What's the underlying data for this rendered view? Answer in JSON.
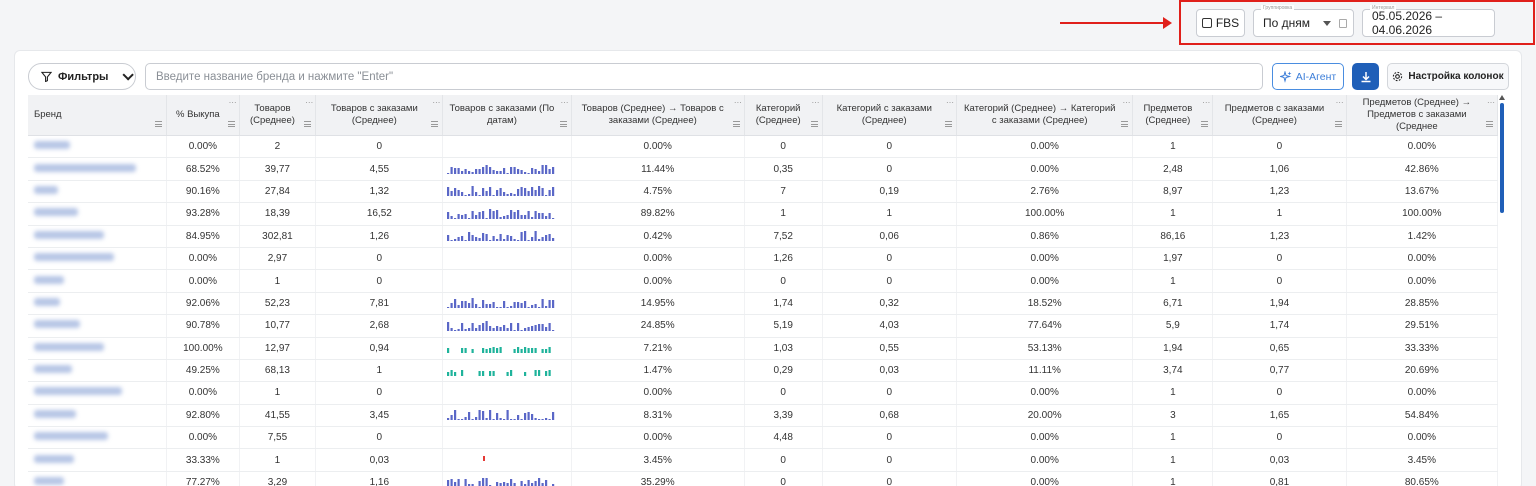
{
  "toolbar": {
    "fbs_label": "FBS",
    "grouping": {
      "label": "Группировка",
      "value": "По дням"
    },
    "interval": {
      "label": "Интервал",
      "value": "05.05.2026 – 04.06.2026"
    }
  },
  "filters": {
    "button_label": "Фильтры",
    "search_placeholder": "Введите название бренда и нажмите \"Enter\"",
    "ai_label": "AI-Агент",
    "columns_label": "Настройка колонок"
  },
  "colors": {
    "accent": "#1f5fb8",
    "highlight": "#e0201b",
    "spark_blue": "#5a67c7",
    "spark_teal": "#1fb39b",
    "spark_red": "#e53935"
  },
  "table": {
    "headers": [
      "Бренд",
      "% Выкупа",
      "Товаров (Среднее)",
      "Товаров с заказами (Среднее)",
      "Товаров с заказами (По датам)",
      "Товаров (Среднее) → Товаров с заказами (Среднее)",
      "Категорий (Среднее)",
      "Категорий с заказами (Среднее)",
      "Категорий (Среднее) → Категорий с заказами (Среднее)",
      "Предметов (Среднее)",
      "Предметов с заказами (Среднее)",
      "Предметов (Среднее) → Предметов с заказами (Среднее"
    ],
    "rows": [
      {
        "c": [
          "0.00%",
          "2",
          "0",
          "0.00%",
          "0",
          "0",
          "0.00%",
          "1",
          "0",
          "0.00%"
        ],
        "spark": "none"
      },
      {
        "c": [
          "68.52%",
          "39,77",
          "4,55",
          "11.44%",
          "0,35",
          "0",
          "0.00%",
          "2,48",
          "1,06",
          "42.86%"
        ],
        "spark": "blue"
      },
      {
        "c": [
          "90.16%",
          "27,84",
          "1,32",
          "4.75%",
          "7",
          "0,19",
          "2.76%",
          "8,97",
          "1,23",
          "13.67%"
        ],
        "spark": "blue"
      },
      {
        "c": [
          "93.28%",
          "18,39",
          "16,52",
          "89.82%",
          "1",
          "1",
          "100.00%",
          "1",
          "1",
          "100.00%"
        ],
        "spark": "blue"
      },
      {
        "c": [
          "84.95%",
          "302,81",
          "1,26",
          "0.42%",
          "7,52",
          "0,06",
          "0.86%",
          "86,16",
          "1,23",
          "1.42%"
        ],
        "spark": "blue"
      },
      {
        "c": [
          "0.00%",
          "2,97",
          "0",
          "0.00%",
          "1,26",
          "0",
          "0.00%",
          "1,97",
          "0",
          "0.00%"
        ],
        "spark": "none"
      },
      {
        "c": [
          "0.00%",
          "1",
          "0",
          "0.00%",
          "0",
          "0",
          "0.00%",
          "1",
          "0",
          "0.00%"
        ],
        "spark": "none"
      },
      {
        "c": [
          "92.06%",
          "52,23",
          "7,81",
          "14.95%",
          "1,74",
          "0,32",
          "18.52%",
          "6,71",
          "1,94",
          "28.85%"
        ],
        "spark": "blue"
      },
      {
        "c": [
          "90.78%",
          "10,77",
          "2,68",
          "24.85%",
          "5,19",
          "4,03",
          "77.64%",
          "5,9",
          "1,74",
          "29.51%"
        ],
        "spark": "blue"
      },
      {
        "c": [
          "100.00%",
          "12,97",
          "0,94",
          "7.21%",
          "1,03",
          "0,55",
          "53.13%",
          "1,94",
          "0,65",
          "33.33%"
        ],
        "spark": "teal"
      },
      {
        "c": [
          "49.25%",
          "68,13",
          "1",
          "1.47%",
          "0,29",
          "0,03",
          "11.11%",
          "3,74",
          "0,77",
          "20.69%"
        ],
        "spark": "teal"
      },
      {
        "c": [
          "0.00%",
          "1",
          "0",
          "0.00%",
          "0",
          "0",
          "0.00%",
          "1",
          "0",
          "0.00%"
        ],
        "spark": "none"
      },
      {
        "c": [
          "92.80%",
          "41,55",
          "3,45",
          "8.31%",
          "3,39",
          "0,68",
          "20.00%",
          "3",
          "1,65",
          "54.84%"
        ],
        "spark": "blue"
      },
      {
        "c": [
          "0.00%",
          "7,55",
          "0",
          "0.00%",
          "4,48",
          "0",
          "0.00%",
          "1",
          "0",
          "0.00%"
        ],
        "spark": "none"
      },
      {
        "c": [
          "33.33%",
          "1",
          "0,03",
          "3.45%",
          "0",
          "0",
          "0.00%",
          "1",
          "0,03",
          "3.45%"
        ],
        "spark": "red"
      },
      {
        "c": [
          "77.27%",
          "3,29",
          "1,16",
          "35.29%",
          "0",
          "0",
          "0.00%",
          "1",
          "0,81",
          "80.65%"
        ],
        "spark": "blue"
      }
    ]
  }
}
